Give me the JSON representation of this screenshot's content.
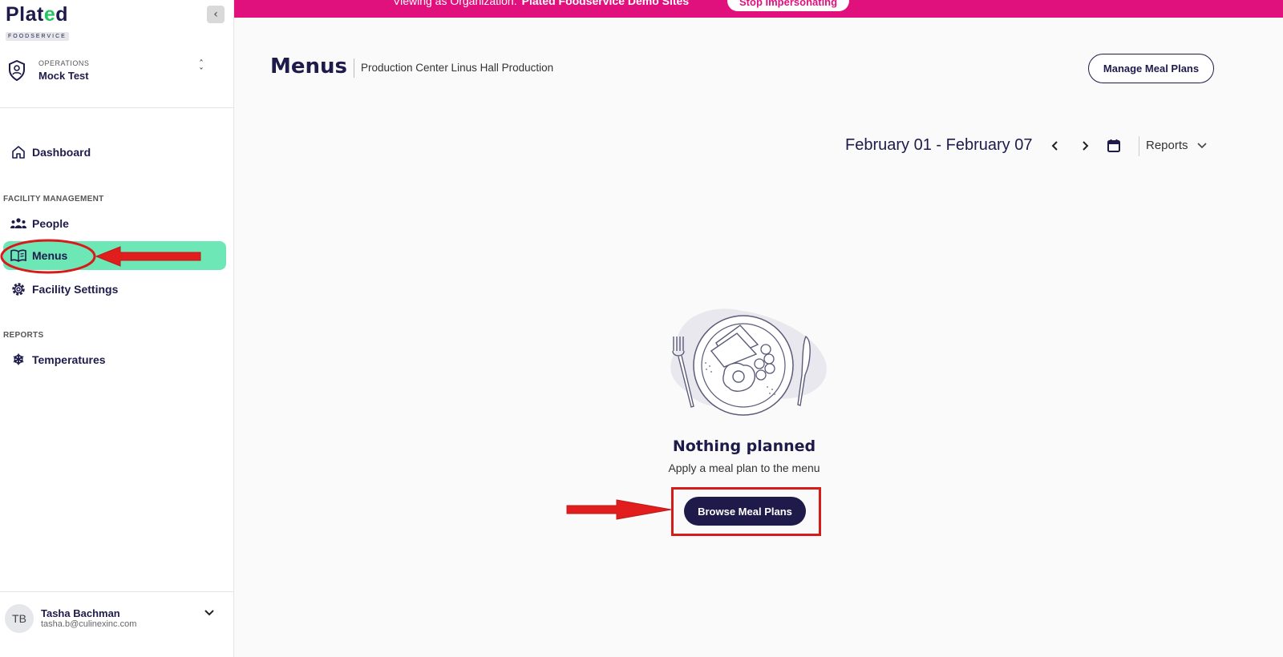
{
  "brand": {
    "wordmark_pre": "Plat",
    "wordmark_e": "e",
    "wordmark_post": "d",
    "sub": "FOODSERVICE"
  },
  "sidebar": {
    "org_kicker": "OPERATIONS",
    "org_name": "Mock Test",
    "dashboard_label": "Dashboard",
    "section_facility": "FACILITY MANAGEMENT",
    "people_label": "People",
    "menus_label": "Menus",
    "facility_settings_label": "Facility Settings",
    "section_reports": "REPORTS",
    "temperatures_label": "Temperatures"
  },
  "user": {
    "initials": "TB",
    "name": "Tasha Bachman",
    "email": "tasha.b@culinexinc.com"
  },
  "banner": {
    "text": "Viewing as Organization:",
    "org": "Plated Foodservice Demo Sites",
    "stop_label": "Stop Impersonating",
    "color": "#e0107d"
  },
  "header": {
    "title": "Menus",
    "subtitle": "Production Center Linus Hall Production",
    "manage_label": "Manage Meal Plans"
  },
  "toolbar": {
    "date_range": "February 01 - February 07",
    "reports_label": "Reports"
  },
  "empty_state": {
    "title": "Nothing planned",
    "subtitle": "Apply a meal plan to the menu",
    "button_label": "Browse Meal Plans"
  },
  "colors": {
    "navy": "#1e1b4b",
    "active_nav": "#6ee7b7",
    "annotation_red": "#d71b1b"
  }
}
